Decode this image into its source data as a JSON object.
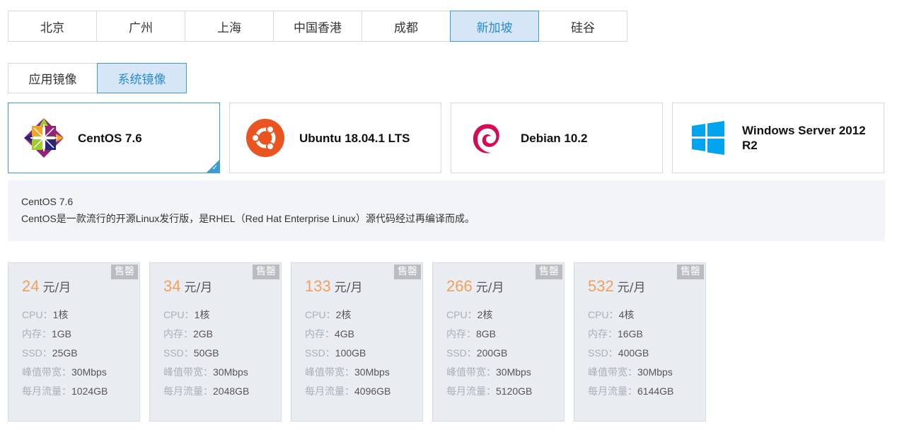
{
  "regions": [
    {
      "label": "北京",
      "active": false
    },
    {
      "label": "广州",
      "active": false
    },
    {
      "label": "上海",
      "active": false
    },
    {
      "label": "中国香港",
      "active": false
    },
    {
      "label": "成都",
      "active": false
    },
    {
      "label": "新加坡",
      "active": true
    },
    {
      "label": "硅谷",
      "active": false
    }
  ],
  "image_types": [
    {
      "label": "应用镜像",
      "active": false
    },
    {
      "label": "系统镜像",
      "active": true
    }
  ],
  "os_options": [
    {
      "name": "CentOS 7.6",
      "icon": "centos-logo-icon",
      "active": true
    },
    {
      "name": "Ubuntu 18.04.1 LTS",
      "icon": "ubuntu-logo-icon",
      "active": false
    },
    {
      "name": "Debian 10.2",
      "icon": "debian-logo-icon",
      "active": false
    },
    {
      "name": "Windows Server 2012 R2",
      "icon": "windows-logo-icon",
      "active": false
    }
  ],
  "description": {
    "title": "CentOS 7.6",
    "text": "CentOS是一款流行的开源Linux发行版，是RHEL（Red Hat Enterprise Linux）源代码经过再编译而成。"
  },
  "plans": [
    {
      "price": "24",
      "unit": "元/月",
      "badge": "售罄",
      "specs": [
        {
          "label": "CPU：",
          "value": "1核"
        },
        {
          "label": "内存：",
          "value": "1GB"
        },
        {
          "label": "SSD：",
          "value": "25GB"
        },
        {
          "label": "峰值带宽：",
          "value": "30Mbps"
        },
        {
          "label": "每月流量：",
          "value": "1024GB"
        }
      ]
    },
    {
      "price": "34",
      "unit": "元/月",
      "badge": "售罄",
      "specs": [
        {
          "label": "CPU：",
          "value": "1核"
        },
        {
          "label": "内存：",
          "value": "2GB"
        },
        {
          "label": "SSD：",
          "value": "50GB"
        },
        {
          "label": "峰值带宽：",
          "value": "30Mbps"
        },
        {
          "label": "每月流量：",
          "value": "2048GB"
        }
      ]
    },
    {
      "price": "133",
      "unit": "元/月",
      "badge": "售罄",
      "specs": [
        {
          "label": "CPU：",
          "value": "2核"
        },
        {
          "label": "内存：",
          "value": "4GB"
        },
        {
          "label": "SSD：",
          "value": "100GB"
        },
        {
          "label": "峰值带宽：",
          "value": "30Mbps"
        },
        {
          "label": "每月流量：",
          "value": "4096GB"
        }
      ]
    },
    {
      "price": "266",
      "unit": "元/月",
      "badge": "售罄",
      "specs": [
        {
          "label": "CPU：",
          "value": "2核"
        },
        {
          "label": "内存：",
          "value": "8GB"
        },
        {
          "label": "SSD：",
          "value": "200GB"
        },
        {
          "label": "峰值带宽：",
          "value": "30Mbps"
        },
        {
          "label": "每月流量：",
          "value": "5120GB"
        }
      ]
    },
    {
      "price": "532",
      "unit": "元/月",
      "badge": "售罄",
      "specs": [
        {
          "label": "CPU：",
          "value": "4核"
        },
        {
          "label": "内存：",
          "value": "16GB"
        },
        {
          "label": "SSD：",
          "value": "400GB"
        },
        {
          "label": "峰值带宽：",
          "value": "30Mbps"
        },
        {
          "label": "每月流量：",
          "value": "6144GB"
        }
      ]
    }
  ],
  "colors": {
    "accent": "#3d9bd8",
    "accent_bg": "#d6e6f7",
    "price": "#f29e5c",
    "sold_badge": "#b9bcc0"
  }
}
